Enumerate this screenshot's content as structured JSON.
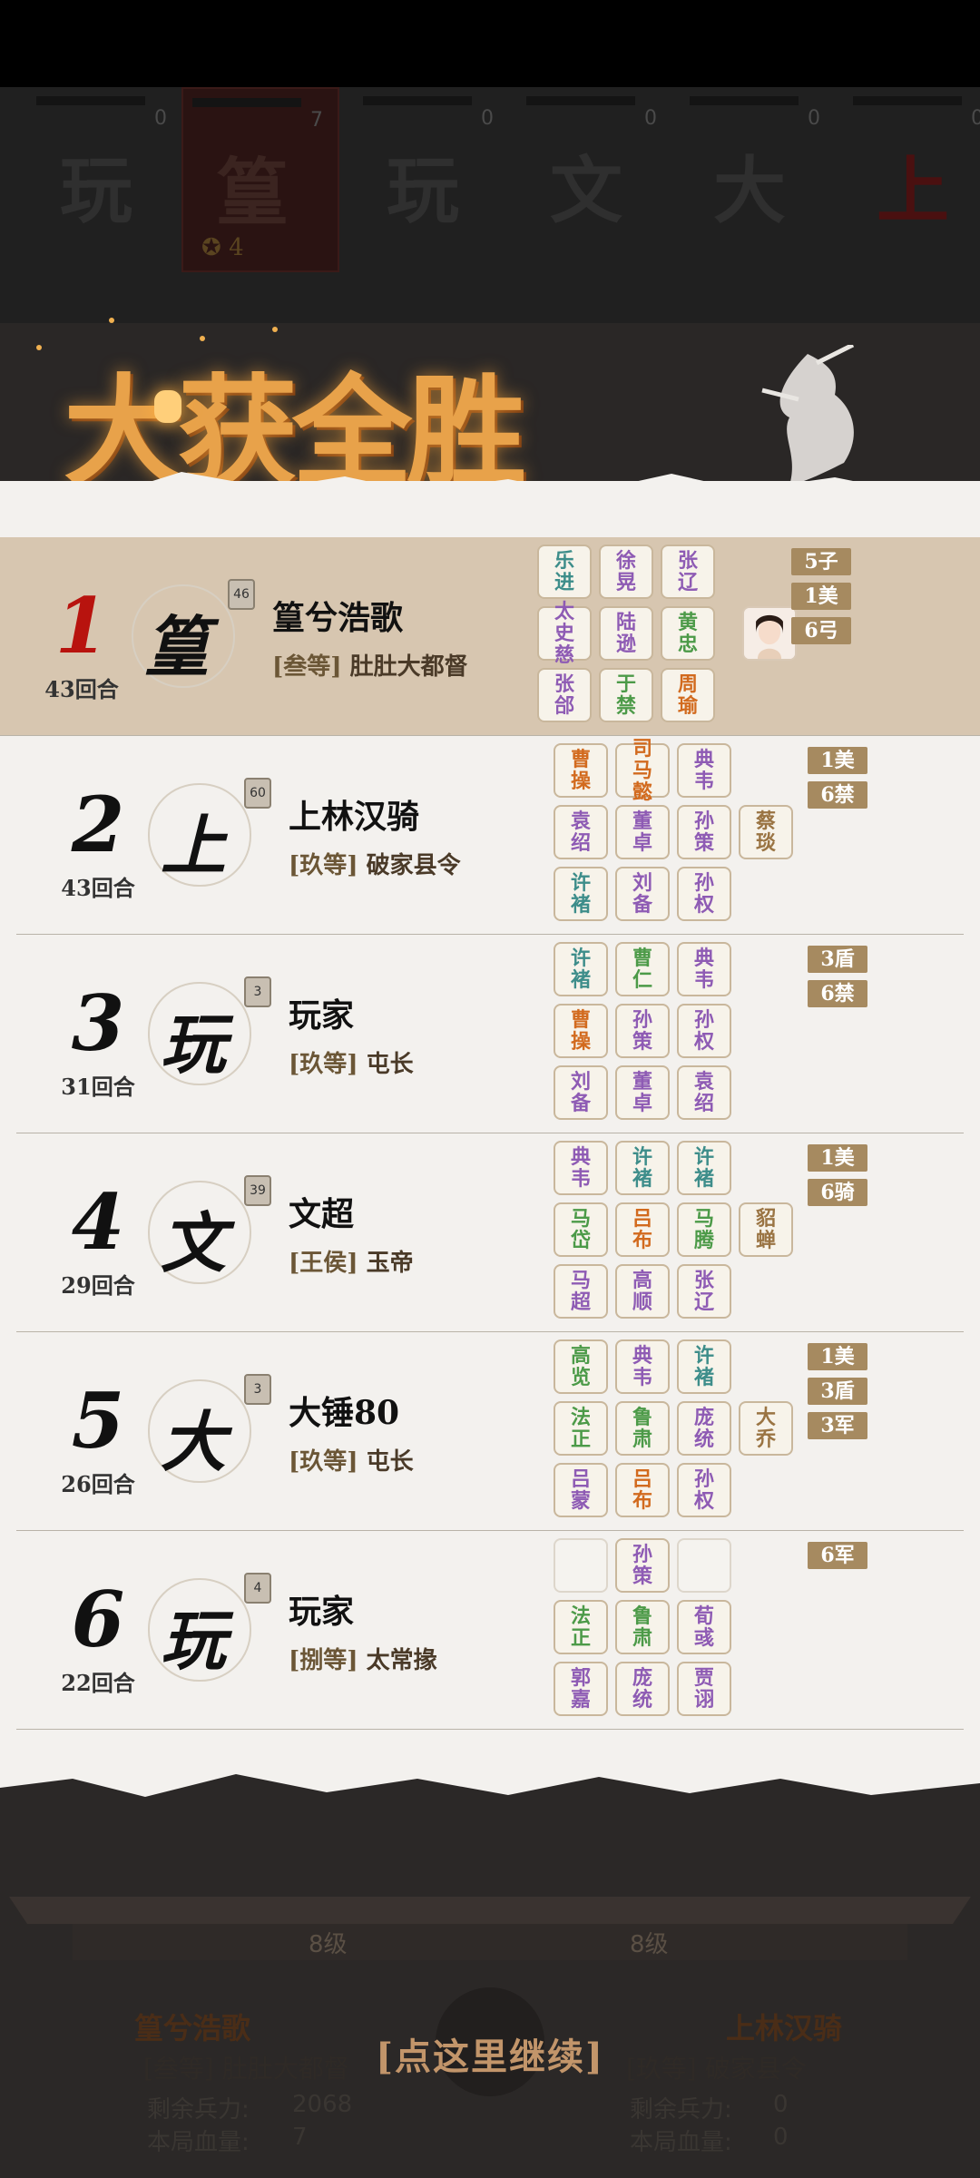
{
  "top_players": [
    {
      "char": "玩",
      "score": "0"
    },
    {
      "char": "篁",
      "score": "7",
      "coins": "4"
    },
    {
      "char": "玩",
      "score": "0"
    },
    {
      "char": "文",
      "score": "0"
    },
    {
      "char": "大",
      "score": "0"
    },
    {
      "char": "上",
      "score": "0"
    }
  ],
  "banner": {
    "title": "大获全胜"
  },
  "rows": [
    {
      "rank": "1",
      "rounds": "43回合",
      "avatar_char": "篁",
      "level": "46",
      "name": "篁兮浩歌",
      "grade": "[叁等]",
      "office": "肚肚大都督",
      "cards": [
        {
          "text": "乐进",
          "color": "c-teal"
        },
        {
          "text": "徐晃",
          "color": "c-purple"
        },
        {
          "text": "张辽",
          "color": "c-purple"
        },
        {
          "text": "太史慈",
          "color": "c-purple"
        },
        {
          "text": "陆逊",
          "color": "c-purple"
        },
        {
          "text": "黄忠",
          "color": "c-green"
        },
        {
          "text": "张郃",
          "color": "c-purple"
        },
        {
          "text": "于禁",
          "color": "c-green"
        },
        {
          "text": "周瑜",
          "color": "c-orange"
        }
      ],
      "badges": [
        "5子",
        "1美",
        "6弓"
      ]
    },
    {
      "rank": "2",
      "rounds": "43回合",
      "avatar_char": "上",
      "level": "60",
      "name": "上林汉骑",
      "grade": "[玖等]",
      "office": "破家县令",
      "cards": [
        {
          "text": "曹操",
          "color": "c-orange"
        },
        {
          "text": "司马懿",
          "color": "c-orange"
        },
        {
          "text": "典韦",
          "color": "c-purple"
        },
        {
          "text": "袁绍",
          "color": "c-purple"
        },
        {
          "text": "董卓",
          "color": "c-purple"
        },
        {
          "text": "孙策",
          "color": "c-purple"
        },
        {
          "text": "许褚",
          "color": "c-teal"
        },
        {
          "text": "刘备",
          "color": "c-purple"
        },
        {
          "text": "孙权",
          "color": "c-purple"
        }
      ],
      "side": {
        "text": "蔡琰",
        "color": "c-brown"
      },
      "badges": [
        "1美",
        "6禁"
      ]
    },
    {
      "rank": "3",
      "rounds": "31回合",
      "avatar_char": "玩",
      "level": "3",
      "name": "玩家",
      "grade": "[玖等]",
      "office": "屯长",
      "cards": [
        {
          "text": "许褚",
          "color": "c-teal"
        },
        {
          "text": "曹仁",
          "color": "c-green"
        },
        {
          "text": "典韦",
          "color": "c-purple"
        },
        {
          "text": "曹操",
          "color": "c-orange"
        },
        {
          "text": "孙策",
          "color": "c-purple"
        },
        {
          "text": "孙权",
          "color": "c-purple"
        },
        {
          "text": "刘备",
          "color": "c-purple"
        },
        {
          "text": "董卓",
          "color": "c-purple"
        },
        {
          "text": "袁绍",
          "color": "c-purple"
        }
      ],
      "badges": [
        "3盾",
        "6禁"
      ]
    },
    {
      "rank": "4",
      "rounds": "29回合",
      "avatar_char": "文",
      "level": "39",
      "name": "文超",
      "grade": "[王侯]",
      "office": "玉帝",
      "cards": [
        {
          "text": "典韦",
          "color": "c-purple"
        },
        {
          "text": "许褚",
          "color": "c-teal"
        },
        {
          "text": "许褚",
          "color": "c-teal"
        },
        {
          "text": "马岱",
          "color": "c-green"
        },
        {
          "text": "吕布",
          "color": "c-orange"
        },
        {
          "text": "马腾",
          "color": "c-green"
        },
        {
          "text": "马超",
          "color": "c-purple"
        },
        {
          "text": "高顺",
          "color": "c-purple"
        },
        {
          "text": "张辽",
          "color": "c-purple"
        }
      ],
      "side": {
        "text": "貂蝉",
        "color": "c-brown"
      },
      "badges": [
        "1美",
        "6骑"
      ]
    },
    {
      "rank": "5",
      "rounds": "26回合",
      "avatar_char": "大",
      "level": "3",
      "name": "大锤80",
      "grade": "[玖等]",
      "office": "屯长",
      "cards": [
        {
          "text": "高览",
          "color": "c-green"
        },
        {
          "text": "典韦",
          "color": "c-purple"
        },
        {
          "text": "许褚",
          "color": "c-teal"
        },
        {
          "text": "法正",
          "color": "c-green"
        },
        {
          "text": "鲁肃",
          "color": "c-green"
        },
        {
          "text": "庞统",
          "color": "c-purple"
        },
        {
          "text": "吕蒙",
          "color": "c-purple"
        },
        {
          "text": "吕布",
          "color": "c-orange"
        },
        {
          "text": "孙权",
          "color": "c-purple"
        }
      ],
      "side": {
        "text": "大乔",
        "color": "c-brown"
      },
      "badges": [
        "1美",
        "3盾",
        "3军"
      ]
    },
    {
      "rank": "6",
      "rounds": "22回合",
      "avatar_char": "玩",
      "level": "4",
      "name": "玩家",
      "grade": "[捌等]",
      "office": "太常掾",
      "cards": [
        {
          "text": "",
          "color": ""
        },
        {
          "text": "孙策",
          "color": "c-purple"
        },
        {
          "text": "",
          "color": ""
        },
        {
          "text": "法正",
          "color": "c-green"
        },
        {
          "text": "鲁肃",
          "color": "c-green"
        },
        {
          "text": "荀彧",
          "color": "c-purple"
        },
        {
          "text": "郭嘉",
          "color": "c-purple"
        },
        {
          "text": "庞统",
          "color": "c-purple"
        },
        {
          "text": "贾诩",
          "color": "c-purple"
        }
      ],
      "badges": [
        "6军"
      ]
    }
  ],
  "bottom": {
    "left_level": "8级",
    "right_level": "8级",
    "left_name": "篁兮浩歌",
    "left_sub": "[叁等] 肚肚大都督",
    "right_name": "上林汉骑",
    "right_sub": "[玖等] 破家县令",
    "left_troops_label": "剩余兵力:",
    "left_troops": "2068",
    "left_hp_label": "本局血量:",
    "left_hp": "7",
    "right_troops_label": "剩余兵力:",
    "right_troops": "0",
    "right_hp_label": "本局血量:",
    "right_hp": "0",
    "continue": "[点这里继续]"
  }
}
